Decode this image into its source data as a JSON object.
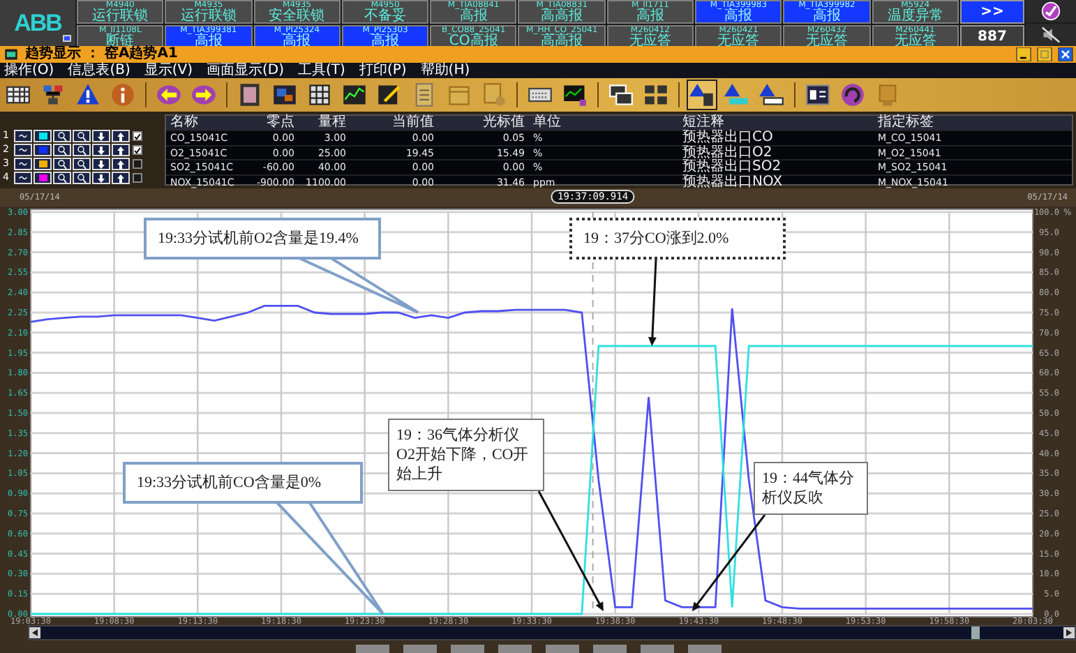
{
  "alarm_bar": {
    "logo": "ABB",
    "buttons": [
      {
        "tag": "M4940",
        "text": "运行联锁",
        "highlighted": false
      },
      {
        "tag": "M4935",
        "text": "运行联锁",
        "highlighted": false
      },
      {
        "tag": "M4935",
        "text": "安全联锁",
        "highlighted": false
      },
      {
        "tag": "M4950",
        "text": "不备妥",
        "highlighted": false
      },
      {
        "tag": "M_TIA08841",
        "text": "高报",
        "highlighted": false
      },
      {
        "tag": "M_TIA08831",
        "text": "高高报",
        "highlighted": false
      },
      {
        "tag": "M_II1711",
        "text": "高报",
        "highlighted": false
      },
      {
        "tag": "M_TIA399983",
        "text": "高报",
        "highlighted": true
      },
      {
        "tag": "M_TIA399982",
        "text": "高报",
        "highlighted": true
      },
      {
        "tag": "M5924",
        "text": "温度异常",
        "highlighted": false
      },
      {
        "tag": "M_II1108L",
        "text": "断链",
        "highlighted": false
      },
      {
        "tag": "M_TIA399381",
        "text": "高报",
        "highlighted": true
      },
      {
        "tag": "M_PI25324",
        "text": "高报",
        "highlighted": true
      },
      {
        "tag": "M_PI25303",
        "text": "高报",
        "highlighted": true
      },
      {
        "tag": "B_CO88_25041",
        "text": "CO高报",
        "highlighted": false
      },
      {
        "tag": "M_HH_CO_25041",
        "text": "高高报",
        "highlighted": false
      },
      {
        "tag": "M260412",
        "text": "无应答",
        "highlighted": false
      },
      {
        "tag": "M260421",
        "text": "无应答",
        "highlighted": false
      },
      {
        "tag": "M260432",
        "text": "无应答",
        "highlighted": false
      },
      {
        "tag": "M260441",
        "text": "无应答",
        "highlighted": false
      }
    ],
    "more": ">>",
    "count": "887"
  },
  "window": {
    "title": "趋势显示 ： 窑A趋势A1"
  },
  "menu": [
    "操作(O)",
    "信息表(B)",
    "显示(V)",
    "画面显示(D)",
    "工具(T)",
    "打印(P)",
    "帮助(H)"
  ],
  "toolbar": [
    {
      "selected": false
    },
    {
      "selected": false
    },
    {
      "selected": false
    },
    {
      "selected": false
    },
    {
      "selected": false
    },
    {
      "selected": false
    },
    {
      "selected": false
    },
    {
      "selected": false
    },
    {
      "selected": false
    },
    {
      "selected": false
    },
    {
      "selected": false
    },
    {
      "selected": false
    },
    {
      "selected": false
    },
    {
      "selected": false
    },
    {
      "selected": false
    },
    {
      "selected": false
    },
    {
      "selected": false
    },
    {
      "selected": false
    },
    {
      "selected": true
    },
    {
      "selected": false
    },
    {
      "selected": false
    },
    {
      "selected": false
    },
    {
      "selected": false
    },
    {
      "selected": false
    }
  ],
  "trend_table": {
    "columns": [
      "名称",
      "零点",
      "量程",
      "当前值",
      "光标值",
      "单位",
      "短注释",
      "指定标签"
    ],
    "rows": [
      {
        "index": "1",
        "color": "#00e8e8",
        "checked": true,
        "cells": [
          "CO_15041C",
          "0.00",
          "3.00",
          "0.00",
          "0.05",
          "%",
          "预热器出口CO",
          "M_CO_15041"
        ]
      },
      {
        "index": "2",
        "color": "#1030ff",
        "checked": true,
        "cells": [
          "O2_15041C",
          "0.00",
          "25.00",
          "19.45",
          "15.49",
          "%",
          "预热器出口O2",
          "M_O2_15041"
        ]
      },
      {
        "index": "3",
        "color": "#f0b000",
        "checked": false,
        "cells": [
          "SO2_15041C",
          "-60.00",
          "40.00",
          "0.00",
          "0.00",
          "%",
          "预热器出口SO2",
          "M_SO2_15041"
        ]
      },
      {
        "index": "4",
        "color": "#f000f0",
        "checked": false,
        "cells": [
          "NOX_15041C",
          "-900.00",
          "1100.00",
          "0.00",
          "31.46",
          "ppm",
          "预热器出口NOX",
          "M_NOX_15041"
        ]
      }
    ]
  },
  "time_bar": {
    "date_left": "05/17/14",
    "cursor_time": "19:37:09.914",
    "date_right": "05/17/14"
  },
  "chart": {
    "right_axis": {
      "unit": "%",
      "labels": [
        "100.0",
        "95.0",
        "90.0",
        "85.0",
        "80.0",
        "75.0",
        "70.0",
        "65.0",
        "60.0",
        "55.0",
        "50.0",
        "45.0",
        "40.0",
        "35.0",
        "30.0",
        "25.0",
        "20.0",
        "15.0",
        "10.0",
        "5.0",
        "0.0"
      ]
    },
    "chart_data": {
      "type": "line",
      "grid": true,
      "ylim": [
        0,
        3
      ],
      "categories": [
        "19:03:30",
        null,
        null,
        null,
        null,
        "19:08:30",
        null,
        null,
        null,
        null,
        "19:13:30",
        null,
        null,
        null,
        null,
        "19:18:30",
        null,
        null,
        null,
        null,
        "19:23:30",
        null,
        null,
        null,
        null,
        "19:28:30",
        null,
        null,
        null,
        null,
        "19:33:30",
        null,
        null,
        null,
        null,
        "19:38:30",
        null,
        null,
        null,
        null,
        "19:43:30",
        null,
        null,
        null,
        null,
        "19:48:30",
        null,
        null,
        null,
        null,
        "19:53:30",
        null,
        null,
        null,
        null,
        "19:58:30",
        null,
        null,
        null,
        null,
        "20:03:30"
      ],
      "series": [
        {
          "color": "#5050f0",
          "values": [
            2.18,
            2.2,
            2.21,
            2.22,
            2.22,
            2.23,
            2.23,
            2.23,
            2.23,
            2.23,
            2.21,
            2.19,
            2.22,
            2.25,
            2.3,
            2.3,
            2.3,
            2.25,
            2.24,
            2.24,
            2.24,
            2.25,
            2.25,
            2.21,
            2.23,
            2.21,
            2.25,
            2.26,
            2.26,
            2.27,
            2.27,
            2.27,
            2.27,
            2.25,
            1.0,
            0.05,
            0.05,
            1.62,
            0.1,
            0.05,
            0.05,
            0.05,
            2.28,
            1.0,
            0.1,
            0.05,
            0.04,
            0.04,
            0.04,
            0.04,
            0.04,
            0.04,
            0.04,
            0.04,
            0.04,
            0.04,
            0.04,
            0.04,
            0.04,
            0.04,
            0.04
          ]
        },
        {
          "color": "#30e0e0",
          "values": [
            0,
            0,
            0,
            0,
            0,
            0,
            0,
            0,
            0,
            0,
            0,
            0,
            0,
            0,
            0,
            0,
            0,
            0,
            0,
            0,
            0,
            0,
            0,
            0,
            0,
            0,
            0,
            0,
            0,
            0,
            0,
            0,
            0,
            0,
            2.0,
            2.0,
            2.0,
            2.0,
            2.0,
            2.0,
            2.0,
            2.0,
            0.05,
            2.0,
            2.0,
            2.0,
            2.0,
            2.0,
            2.0,
            2.0,
            2.0,
            2.0,
            2.0,
            2.0,
            2.0,
            2.0,
            2.0,
            2.0,
            2.0,
            2.0,
            2.0
          ]
        }
      ],
      "yticks": [
        {
          "value": 3,
          "label": "3.00"
        },
        {
          "value": 2.85,
          "label": "2.85"
        },
        {
          "value": 2.7,
          "label": "2.70"
        },
        {
          "value": 2.55,
          "label": "2.55"
        },
        {
          "value": 2.4,
          "label": "2.40"
        },
        {
          "value": 2.25,
          "label": "2.25"
        },
        {
          "value": 2.1,
          "label": "2.10"
        },
        {
          "value": 1.95,
          "label": "1.95"
        },
        {
          "value": 1.8,
          "label": "1.80"
        },
        {
          "value": 1.65,
          "label": "1.65"
        },
        {
          "value": 1.5,
          "label": "1.50"
        },
        {
          "value": 1.35,
          "label": "1.35"
        },
        {
          "value": 1.2,
          "label": "1.20"
        },
        {
          "value": 1.05,
          "label": "1.05"
        },
        {
          "value": 0.9,
          "label": "0.90"
        },
        {
          "value": 0.75,
          "label": "0.75"
        },
        {
          "value": 0.6,
          "label": "0.60"
        },
        {
          "value": 0.45,
          "label": "0.45"
        },
        {
          "value": 0.3,
          "label": "0.30"
        },
        {
          "value": 0.15,
          "label": "0.15"
        },
        {
          "value": 0,
          "label": "0.00"
        }
      ]
    },
    "callouts": [
      {
        "kind": "wedge",
        "text": "19:33分试机前O2含量是19.4%"
      },
      {
        "kind": "dotted",
        "text": "19：37分CO涨到2.0%"
      },
      {
        "kind": "arrow",
        "text": "19：36气体分析仪O2开始下降，CO开始上升"
      },
      {
        "kind": "wedge",
        "text": "19:33分试机前CO含量是0%"
      },
      {
        "kind": "arrow",
        "text": "19：44气体分析仪反吹"
      }
    ]
  }
}
